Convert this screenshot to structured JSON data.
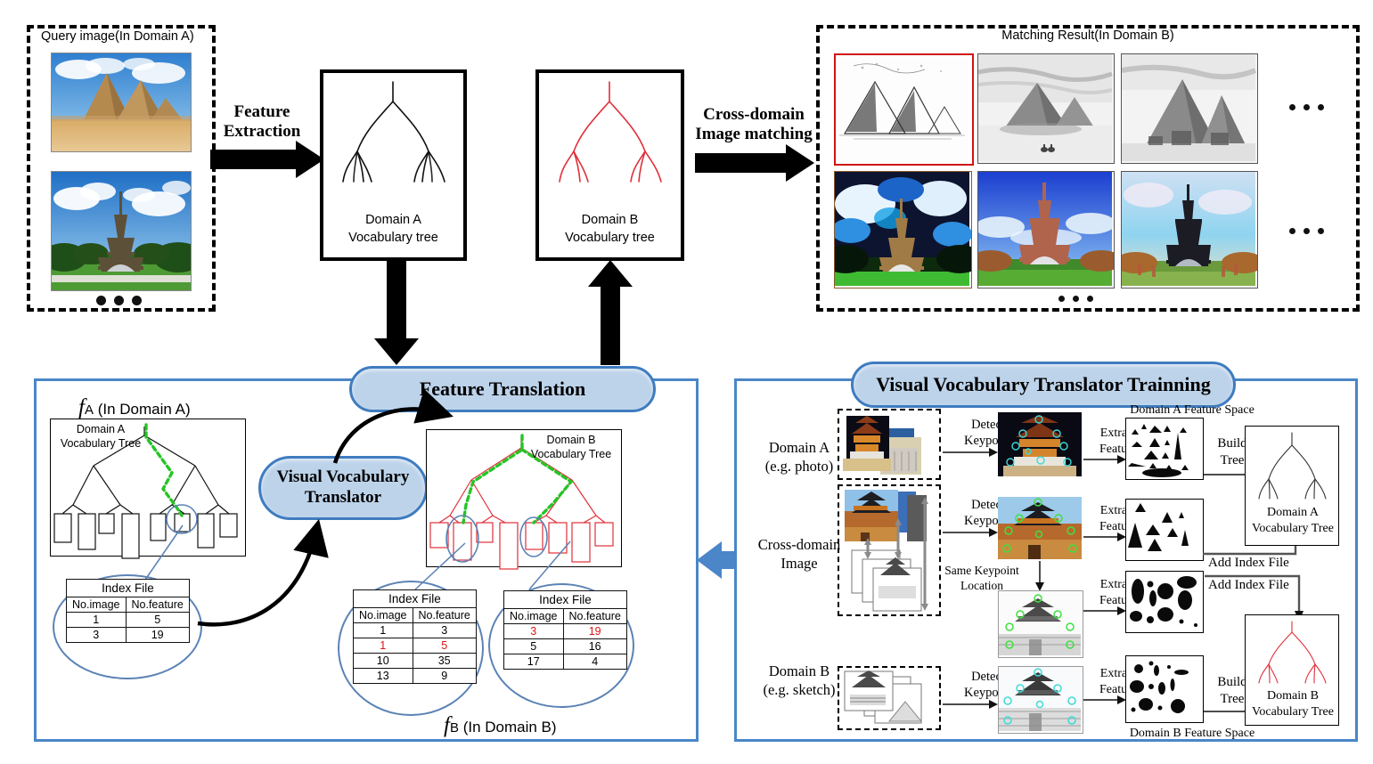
{
  "top": {
    "query_panel_title": "Query image(In Domain A)",
    "query_images": [
      "pyramids-photo",
      "eiffel-tower-photo"
    ],
    "feature_extraction_label_line1": "Feature",
    "feature_extraction_label_line2": "Extraction",
    "domain_a_tree": {
      "line1": "Domain A",
      "line2": "Vocabulary tree"
    },
    "domain_b_tree": {
      "line1": "Domain B",
      "line2": "Vocabulary tree"
    },
    "cross_domain_label_line1": "Cross-domain",
    "cross_domain_label_line2": "Image matching",
    "matching_panel_title": "Matching Result(In Domain B)",
    "matching_images_row1": [
      "pyramids-sketch-1",
      "pyramids-sketch-2",
      "pyramids-sketch-3"
    ],
    "matching_images_row2": [
      "eiffel-painting-1",
      "eiffel-painting-2",
      "eiffel-painting-3"
    ]
  },
  "translation": {
    "panel_title": "Feature Translation",
    "translator_pill_line1": "Visual Vocabulary",
    "translator_pill_line2": "Translator",
    "fa_label_main": "f",
    "fa_label_sub": "A",
    "fa_label_rest": " (In Domain A)",
    "fb_label_main": "f",
    "fb_label_sub": "B",
    "fb_label_rest": " (In Domain B)",
    "tree_a_label_line1": "Domain A",
    "tree_a_label_line2": "Vocabulary Tree",
    "tree_b_label_line1": "Domain B",
    "tree_b_label_line2": "Vocabulary Tree",
    "index_tables": [
      {
        "title": "Index File",
        "columns": [
          "No.image",
          "No.feature"
        ],
        "rows": [
          {
            "cells": [
              "1",
              "5"
            ],
            "highlight": [
              false,
              false
            ]
          },
          {
            "cells": [
              "3",
              "19"
            ],
            "highlight": [
              false,
              false
            ]
          }
        ]
      },
      {
        "title": "Index File",
        "columns": [
          "No.image",
          "No.feature"
        ],
        "rows": [
          {
            "cells": [
              "1",
              "3"
            ],
            "highlight": [
              false,
              false
            ]
          },
          {
            "cells": [
              "1",
              "5"
            ],
            "highlight": [
              true,
              true
            ]
          },
          {
            "cells": [
              "10",
              "35"
            ],
            "highlight": [
              false,
              false
            ]
          },
          {
            "cells": [
              "13",
              "9"
            ],
            "highlight": [
              false,
              false
            ]
          }
        ]
      },
      {
        "title": "Index File",
        "columns": [
          "No.image",
          "No.feature"
        ],
        "rows": [
          {
            "cells": [
              "3",
              "19"
            ],
            "highlight": [
              true,
              true
            ]
          },
          {
            "cells": [
              "5",
              "16"
            ],
            "highlight": [
              false,
              false
            ]
          },
          {
            "cells": [
              "17",
              "4"
            ],
            "highlight": [
              false,
              false
            ]
          }
        ]
      }
    ]
  },
  "training": {
    "panel_title": "Visual Vocabulary Translator Trainning",
    "rows": [
      {
        "label_line1": "Domain A",
        "label_line2": "(e.g. photo)"
      },
      {
        "label_line1": "Cross-domain",
        "label_line2": "Image"
      },
      {
        "label_line1": "Domain B",
        "label_line2": "(e.g. sketch)"
      }
    ],
    "detect_keypoint_line1": "Detect",
    "detect_keypoint_line2": "Keypoint",
    "extract_feature_line1": "Extract",
    "extract_feature_line2": "Feature",
    "same_keypoint_line1": "Same Keypoint",
    "same_keypoint_line2": "Location",
    "feature_space_a": "Domain A  Feature Space",
    "feature_space_b": "Domain B  Feature Space",
    "build_tree_line1": "Build",
    "build_tree_line2": "Tree",
    "add_index_file": "Add Index File",
    "tree_a_line1": "Domain A",
    "tree_a_line2": "Vocabulary Tree",
    "tree_b_line1": "Domain B",
    "tree_b_line2": "Vocabulary Tree"
  },
  "colors": {
    "accent_blue": "#4a86c8",
    "pill_fill": "#bdd3ea",
    "pill_border": "#3f7cc0",
    "tree_red": "#e0303a",
    "path_green": "#25c525",
    "highlight_red": "#e11212",
    "select_ellipse": "#5b83b5"
  }
}
